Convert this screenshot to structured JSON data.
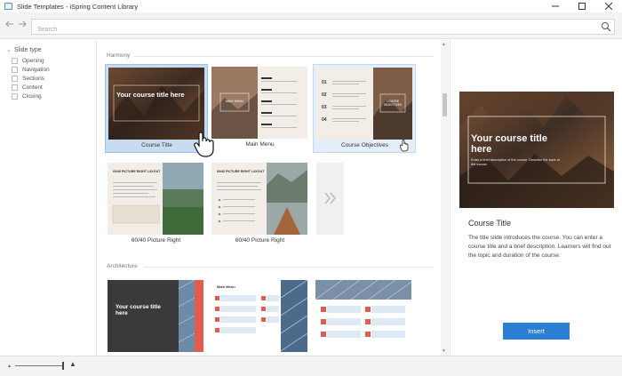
{
  "window": {
    "title": "Slide Templates - iSpring Content Library"
  },
  "toolbar": {
    "search_placeholder": "Search"
  },
  "sidebar": {
    "header": "Slide type",
    "items": [
      {
        "label": "Opening"
      },
      {
        "label": "Navigation"
      },
      {
        "label": "Sections"
      },
      {
        "label": "Content"
      },
      {
        "label": "Closing"
      }
    ]
  },
  "gallery": {
    "sections": [
      {
        "title": "Harmony",
        "tiles": [
          {
            "label": "Course Title",
            "state": "selected",
            "thumb_title": "Your course title here"
          },
          {
            "label": "Main Menu",
            "state": "normal",
            "thumb_title": "MAIN MENU"
          },
          {
            "label": "Course Objectives",
            "state": "hover",
            "thumb_title": "COURSE OBJECTIVES"
          },
          {
            "label": "60/40 Picture Right",
            "state": "normal",
            "thumb_title": "60/40 PICTURE RIGHT LAYOUT"
          },
          {
            "label": "60/40 Picture Right",
            "state": "normal",
            "thumb_title": "60/40 PICTURE RIGHT LAYOUT"
          }
        ]
      },
      {
        "title": "Architecture",
        "tiles": [
          {
            "thumb_title": "Your course title here"
          },
          {
            "thumb_title": "Main Menu"
          },
          {
            "thumb_title": ""
          }
        ]
      }
    ]
  },
  "preview": {
    "heading": "Your course title here",
    "subheading": "Enter a brief description of the course. Describe the topic of the course.",
    "title": "Course Title",
    "description": "The title slide introduces the course. You can enter a course title and a brief description. Learners will find out the topic and duration of the course.",
    "insert_label": "Insert"
  },
  "colors": {
    "accent": "#2d7fd3",
    "selection": "#c8dcf0",
    "harmony_dark": "#3b2b22",
    "architecture_red": "#e25b4b"
  }
}
